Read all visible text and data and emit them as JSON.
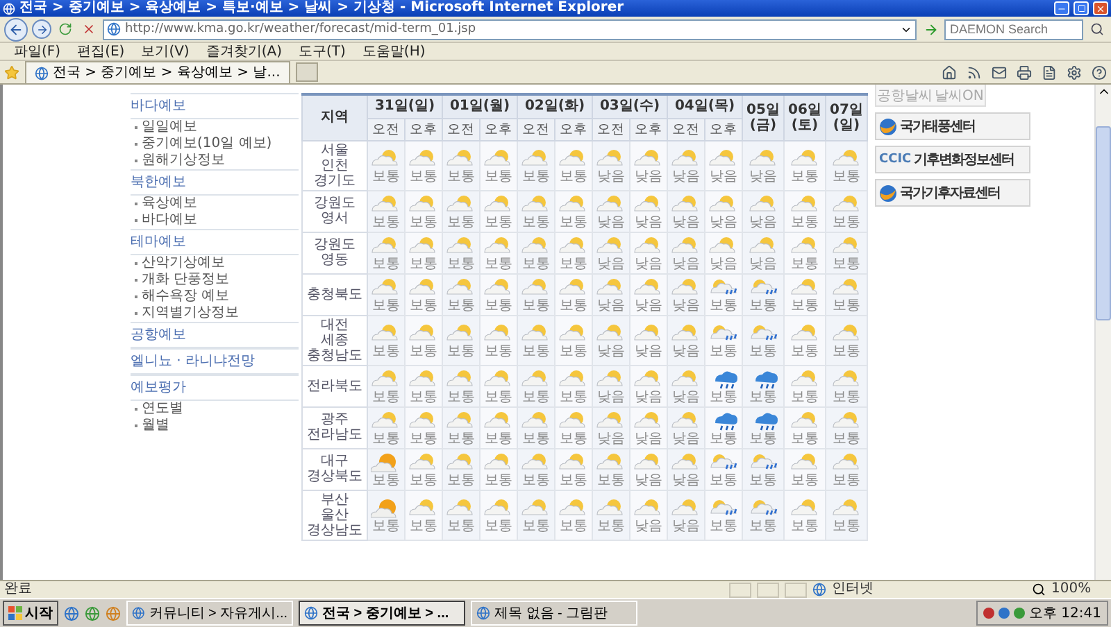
{
  "window": {
    "title": "전국 > 중기예보 > 육상예보 > 특보·예보 > 날씨 > 기상청 - Microsoft Internet Explorer"
  },
  "address_bar": {
    "url": "http://www.kma.go.kr/weather/forecast/mid-term_01.jsp"
  },
  "search": {
    "placeholder": "DAEMON Search"
  },
  "menu": [
    "파일(F)",
    "편집(E)",
    "보기(V)",
    "즐겨찾기(A)",
    "도구(T)",
    "도움말(H)"
  ],
  "tab": {
    "label": "전국 > 중기예보 > 육상예보 > 날..."
  },
  "sidebar": {
    "sections": [
      {
        "title": "바다예보",
        "items": [
          "일일예보",
          "중기예보(10일 예보)",
          "원해기상정보"
        ]
      },
      {
        "title": "북한예보",
        "items": [
          "육상예보",
          "바다예보"
        ]
      },
      {
        "title": "테마예보",
        "items": [
          "산악기상예보",
          "개화 단풍정보",
          "해수욕장 예보",
          "지역별기상정보"
        ]
      },
      {
        "title": "공항예보"
      },
      {
        "title": "엘니뇨 · 라니냐전망"
      },
      {
        "title": "예보평가",
        "items": [
          "연도별",
          "월별"
        ]
      }
    ]
  },
  "forecast_table": {
    "region_header": "지역",
    "days": [
      {
        "label": "31일(일)",
        "halves": [
          "오전",
          "오후"
        ]
      },
      {
        "label": "01일(월)",
        "halves": [
          "오전",
          "오후"
        ]
      },
      {
        "label": "02일(화)",
        "halves": [
          "오전",
          "오후"
        ]
      },
      {
        "label": "03일(수)",
        "halves": [
          "오전",
          "오후"
        ]
      },
      {
        "label": "04일(목)",
        "halves": [
          "오전",
          "오후"
        ]
      },
      {
        "label": "05일 (금)"
      },
      {
        "label": "06일 (토)"
      },
      {
        "label": "07일 (일)"
      }
    ],
    "rows": [
      {
        "region": [
          "서울",
          "인천",
          "경기도"
        ],
        "cells": [
          {
            "kind": "partly",
            "text": "보통"
          },
          {
            "kind": "partly",
            "text": "보통"
          },
          {
            "kind": "partly",
            "text": "보통"
          },
          {
            "kind": "partly",
            "text": "보통"
          },
          {
            "kind": "partly",
            "text": "보통"
          },
          {
            "kind": "partly",
            "text": "보통"
          },
          {
            "kind": "partly",
            "text": "낮음"
          },
          {
            "kind": "partly",
            "text": "낮음"
          },
          {
            "kind": "partly",
            "text": "낮음"
          },
          {
            "kind": "partly",
            "text": "낮음"
          },
          {
            "kind": "partly",
            "text": "낮음"
          },
          {
            "kind": "partly",
            "text": "보통"
          },
          {
            "kind": "partly",
            "text": "보통"
          }
        ]
      },
      {
        "region": [
          "강원도",
          "영서"
        ],
        "cells": [
          {
            "kind": "partly",
            "text": "보통"
          },
          {
            "kind": "partly",
            "text": "보통"
          },
          {
            "kind": "partly",
            "text": "보통"
          },
          {
            "kind": "partly",
            "text": "보통"
          },
          {
            "kind": "partly",
            "text": "보통"
          },
          {
            "kind": "partly",
            "text": "보통"
          },
          {
            "kind": "partly",
            "text": "낮음"
          },
          {
            "kind": "partly",
            "text": "낮음"
          },
          {
            "kind": "partly",
            "text": "낮음"
          },
          {
            "kind": "partly",
            "text": "낮음"
          },
          {
            "kind": "partly",
            "text": "낮음"
          },
          {
            "kind": "partly",
            "text": "보통"
          },
          {
            "kind": "partly",
            "text": "보통"
          }
        ]
      },
      {
        "region": [
          "강원도",
          "영동"
        ],
        "cells": [
          {
            "kind": "partly",
            "text": "보통"
          },
          {
            "kind": "partly",
            "text": "보통"
          },
          {
            "kind": "partly",
            "text": "보통"
          },
          {
            "kind": "partly",
            "text": "보통"
          },
          {
            "kind": "partly",
            "text": "보통"
          },
          {
            "kind": "partly",
            "text": "보통"
          },
          {
            "kind": "partly",
            "text": "낮음"
          },
          {
            "kind": "partly",
            "text": "낮음"
          },
          {
            "kind": "partly",
            "text": "낮음"
          },
          {
            "kind": "partly",
            "text": "낮음"
          },
          {
            "kind": "partly",
            "text": "낮음"
          },
          {
            "kind": "partly",
            "text": "보통"
          },
          {
            "kind": "partly",
            "text": "보통"
          }
        ]
      },
      {
        "region": [
          "충청북도"
        ],
        "cells": [
          {
            "kind": "partly",
            "text": "보통"
          },
          {
            "kind": "partly",
            "text": "보통"
          },
          {
            "kind": "partly",
            "text": "보통"
          },
          {
            "kind": "partly",
            "text": "보통"
          },
          {
            "kind": "partly",
            "text": "보통"
          },
          {
            "kind": "partly",
            "text": "보통"
          },
          {
            "kind": "partly",
            "text": "낮음"
          },
          {
            "kind": "partly",
            "text": "낮음"
          },
          {
            "kind": "partly",
            "text": "낮음"
          },
          {
            "kind": "rain",
            "text": "보통"
          },
          {
            "kind": "rain",
            "text": "보통"
          },
          {
            "kind": "partly",
            "text": "보통"
          },
          {
            "kind": "partly",
            "text": "보통"
          }
        ]
      },
      {
        "region": [
          "대전",
          "세종",
          "충청남도"
        ],
        "cells": [
          {
            "kind": "partly",
            "text": "보통"
          },
          {
            "kind": "partly",
            "text": "보통"
          },
          {
            "kind": "partly",
            "text": "보통"
          },
          {
            "kind": "partly",
            "text": "보통"
          },
          {
            "kind": "partly",
            "text": "보통"
          },
          {
            "kind": "partly",
            "text": "보통"
          },
          {
            "kind": "partly",
            "text": "낮음"
          },
          {
            "kind": "partly",
            "text": "낮음"
          },
          {
            "kind": "partly",
            "text": "낮음"
          },
          {
            "kind": "rain",
            "text": "보통"
          },
          {
            "kind": "rain",
            "text": "보통"
          },
          {
            "kind": "partly",
            "text": "보통"
          },
          {
            "kind": "partly",
            "text": "보통"
          }
        ]
      },
      {
        "region": [
          "전라북도"
        ],
        "cells": [
          {
            "kind": "partly",
            "text": "보통"
          },
          {
            "kind": "partly",
            "text": "보통"
          },
          {
            "kind": "partly",
            "text": "보통"
          },
          {
            "kind": "partly",
            "text": "보통"
          },
          {
            "kind": "partly",
            "text": "보통"
          },
          {
            "kind": "partly",
            "text": "보통"
          },
          {
            "kind": "partly",
            "text": "낮음"
          },
          {
            "kind": "partly",
            "text": "낮음"
          },
          {
            "kind": "partly",
            "text": "낮음"
          },
          {
            "kind": "heavy",
            "text": "보통"
          },
          {
            "kind": "heavy",
            "text": "보통"
          },
          {
            "kind": "partly",
            "text": "보통"
          },
          {
            "kind": "partly",
            "text": "보통"
          }
        ]
      },
      {
        "region": [
          "광주",
          "전라남도"
        ],
        "cells": [
          {
            "kind": "partly",
            "text": "보통"
          },
          {
            "kind": "partly",
            "text": "보통"
          },
          {
            "kind": "partly",
            "text": "보통"
          },
          {
            "kind": "partly",
            "text": "보통"
          },
          {
            "kind": "partly",
            "text": "보통"
          },
          {
            "kind": "partly",
            "text": "보통"
          },
          {
            "kind": "partly",
            "text": "낮음"
          },
          {
            "kind": "partly",
            "text": "낮음"
          },
          {
            "kind": "partly",
            "text": "낮음"
          },
          {
            "kind": "heavy",
            "text": "보통"
          },
          {
            "kind": "heavy",
            "text": "보통"
          },
          {
            "kind": "partly",
            "text": "보통"
          },
          {
            "kind": "partly",
            "text": "보통"
          }
        ]
      },
      {
        "region": [
          "대구",
          "경상북도"
        ],
        "cells": [
          {
            "kind": "sunny",
            "text": "보통"
          },
          {
            "kind": "partly",
            "text": "보통"
          },
          {
            "kind": "partly",
            "text": "보통"
          },
          {
            "kind": "partly",
            "text": "보통"
          },
          {
            "kind": "partly",
            "text": "보통"
          },
          {
            "kind": "partly",
            "text": "보통"
          },
          {
            "kind": "partly",
            "text": "보통"
          },
          {
            "kind": "partly",
            "text": "낮음"
          },
          {
            "kind": "partly",
            "text": "낮음"
          },
          {
            "kind": "rain",
            "text": "보통"
          },
          {
            "kind": "rain",
            "text": "보통"
          },
          {
            "kind": "partly",
            "text": "보통"
          },
          {
            "kind": "partly",
            "text": "보통"
          }
        ]
      },
      {
        "region": [
          "부산",
          "울산",
          "경상남도"
        ],
        "cells": [
          {
            "kind": "sunny",
            "text": "보통"
          },
          {
            "kind": "partly",
            "text": "보통"
          },
          {
            "kind": "partly",
            "text": "보통"
          },
          {
            "kind": "partly",
            "text": "보통"
          },
          {
            "kind": "partly",
            "text": "보통"
          },
          {
            "kind": "partly",
            "text": "보통"
          },
          {
            "kind": "partly",
            "text": "보통"
          },
          {
            "kind": "partly",
            "text": "낮음"
          },
          {
            "kind": "partly",
            "text": "낮음"
          },
          {
            "kind": "rain",
            "text": "보통"
          },
          {
            "kind": "rain",
            "text": "보통"
          },
          {
            "kind": "partly",
            "text": "보통"
          },
          {
            "kind": "partly",
            "text": "보통"
          }
        ]
      }
    ]
  },
  "right_panel": {
    "tabs": [
      "공항날씨",
      "날씨ON"
    ],
    "banners": [
      {
        "kind": "swoosh",
        "label": "국가태풍센터"
      },
      {
        "kind": "ccic",
        "logo": "CCIC",
        "label": "기후변화정보센터"
      },
      {
        "kind": "swoosh",
        "label": "국가기후자료센터"
      }
    ]
  },
  "status_bar": {
    "text": "완료",
    "zone": "인터넷",
    "zoom": "100%"
  },
  "taskbar": {
    "start": "시작",
    "tasks": [
      {
        "label": "커뮤니티 > 자유게시...",
        "selected": false
      },
      {
        "label": "전국 > 중기예보 > ...",
        "selected": true
      },
      {
        "label": "제목 없음 - 그림판",
        "selected": false
      }
    ],
    "clock": "오후 12:41"
  }
}
